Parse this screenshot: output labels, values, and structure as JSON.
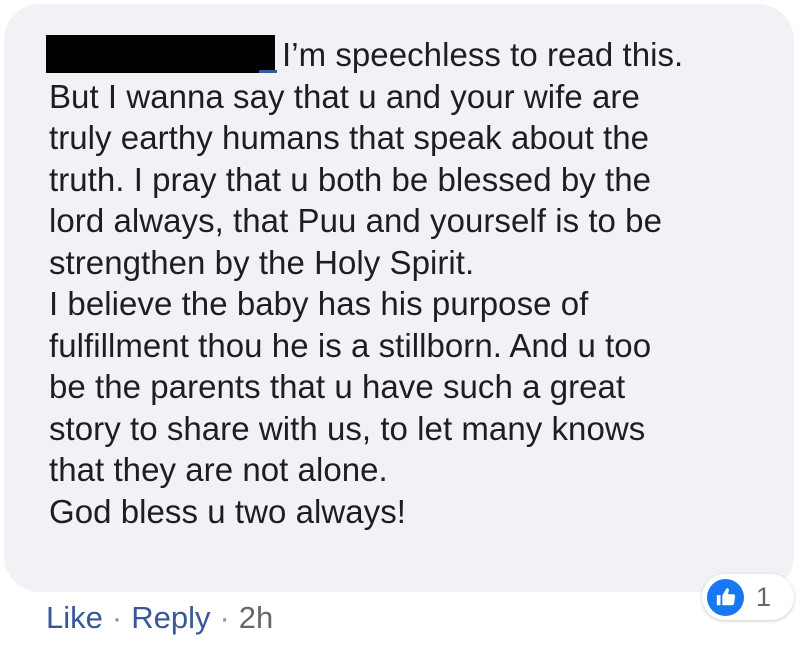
{
  "comment": {
    "lines": [
      "I’m speechless to read this.",
      "But I wanna say that u and your wife are",
      "truly earthy humans that speak about the",
      "truth. I pray that u both be blessed by the",
      "lord always, that Puu and yourself is to be",
      "strengthen by the Holy Spirit.",
      "I believe the baby has his purpose of",
      "fulfillment thou he is a stillborn. And u too",
      "be the parents that u have such a great",
      "story to share with us, to let many knows",
      "that they are not alone.",
      "God bless u two always!"
    ]
  },
  "reactions": {
    "icon": "thumbs-up-icon",
    "count": "1",
    "badge_color": "#1877f2"
  },
  "actions": {
    "like_label": "Like",
    "separator": "·",
    "reply_label": "Reply",
    "timestamp": "2h",
    "link_color": "#385898"
  },
  "bubble_color": "#f0f2f5"
}
